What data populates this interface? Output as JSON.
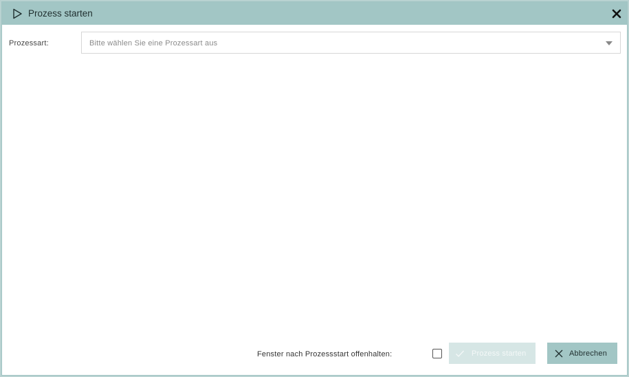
{
  "dialog": {
    "title": "Prozess starten",
    "title_icon": "play-outline-icon",
    "close_icon": "close-icon"
  },
  "form": {
    "process_type_label": "Prozessart:",
    "process_type_placeholder": "Bitte wählen Sie eine Prozessart aus",
    "dropdown_icon": "caret-down-icon"
  },
  "footer": {
    "keep_open_label": "Fenster nach Prozessstart offenhalten:",
    "keep_open_checked": false,
    "start_button_label": "Prozess starten",
    "start_button_icon": "check-icon",
    "start_button_enabled": false,
    "cancel_button_label": "Abbrechen",
    "cancel_button_icon": "x-icon"
  },
  "colors": {
    "accent": "#a2c6c5",
    "disabled_button": "#d6e6e5",
    "background": "#ffffff"
  }
}
